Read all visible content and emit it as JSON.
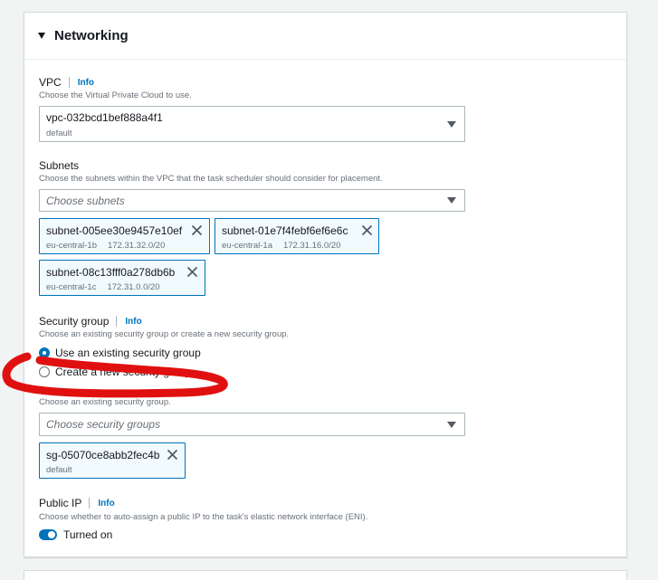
{
  "section": {
    "title": "Networking"
  },
  "vpc": {
    "label": "VPC",
    "info": "Info",
    "description": "Choose the Virtual Private Cloud to use.",
    "selected_value": "vpc-032bcd1bef888a4f1",
    "selected_sub": "default"
  },
  "subnets": {
    "label": "Subnets",
    "description": "Choose the subnets within the VPC that the task scheduler should consider for placement.",
    "placeholder": "Choose subnets",
    "tokens": [
      {
        "id": "subnet-005ee30e9457e10ef",
        "az": "eu-central-1b",
        "cidr": "172.31.32.0/20"
      },
      {
        "id": "subnet-01e7f4febf6ef6e6c",
        "az": "eu-central-1a",
        "cidr": "172.31.16.0/20"
      },
      {
        "id": "subnet-08c13fff0a278db6b",
        "az": "eu-central-1c",
        "cidr": "172.31.0.0/20"
      }
    ]
  },
  "security_group": {
    "label": "Security group",
    "info": "Info",
    "description": "Choose an existing security group or create a new security group.",
    "options": [
      {
        "label": "Use an existing security group",
        "checked": true
      },
      {
        "label": "Create a new security group",
        "checked": false
      }
    ],
    "sub_description": "Choose an existing security group.",
    "placeholder": "Choose security groups",
    "tokens": [
      {
        "id": "sg-05070ce8abb2fec4b",
        "sub": "default"
      }
    ]
  },
  "public_ip": {
    "label": "Public IP",
    "info": "Info",
    "description": "Choose whether to auto-assign a public IP to the task's elastic network interface (ENI).",
    "toggle_label": "Turned on",
    "enabled": true
  },
  "colors": {
    "accent": "#0073bb",
    "annotation": "#e01010"
  }
}
